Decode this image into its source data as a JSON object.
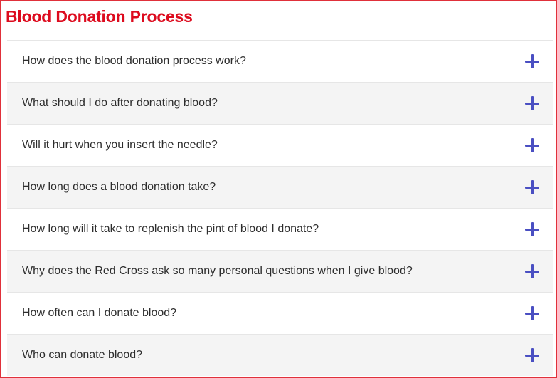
{
  "page": {
    "title": "Blood Donation Process"
  },
  "colors": {
    "title": "#dd0b1e",
    "frame_border": "#e0303a",
    "icon": "#4a4fc2",
    "row_alt_background": "#f4f4f4"
  },
  "faq": {
    "expand_icon": "plus-icon",
    "items": [
      {
        "question": "How does the blood donation process work?"
      },
      {
        "question": "What should I do after donating blood?"
      },
      {
        "question": "Will it hurt when you insert the needle?"
      },
      {
        "question": "How long does a blood donation take?"
      },
      {
        "question": "How long will it take to replenish the pint of blood I donate?"
      },
      {
        "question": "Why does the Red Cross ask so many personal questions when I give blood?"
      },
      {
        "question": "How often can I donate blood?"
      },
      {
        "question": "Who can donate blood?"
      }
    ]
  }
}
